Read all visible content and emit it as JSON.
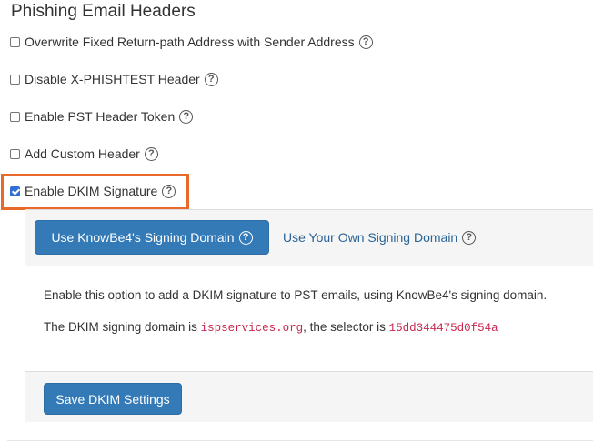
{
  "section_title": "Phishing Email Headers",
  "options": [
    {
      "label": "Overwrite Fixed Return-path Address with Sender Address",
      "checked": false
    },
    {
      "label": "Disable X-PHISHTEST Header",
      "checked": false
    },
    {
      "label": "Enable PST Header Token",
      "checked": false
    },
    {
      "label": "Add Custom Header",
      "checked": false
    },
    {
      "label": "Enable DKIM Signature",
      "checked": true
    }
  ],
  "help_glyph": "?",
  "dkim": {
    "tab_knowbe4": "Use KnowBe4's Signing Domain",
    "tab_own": "Use Your Own Signing Domain",
    "description": "Enable this option to add a DKIM signature to PST emails, using KnowBe4's signing domain.",
    "domain_prefix": "The DKIM signing domain is ",
    "domain": "ispservices.org",
    "selector_prefix": ", the selector is ",
    "selector": "15dd344475d0f54a",
    "save_label": "Save DKIM Settings"
  },
  "colors": {
    "primary": "#337ab7",
    "highlight": "#e8692a",
    "link": "#2a6496",
    "code": "#c7254e"
  }
}
